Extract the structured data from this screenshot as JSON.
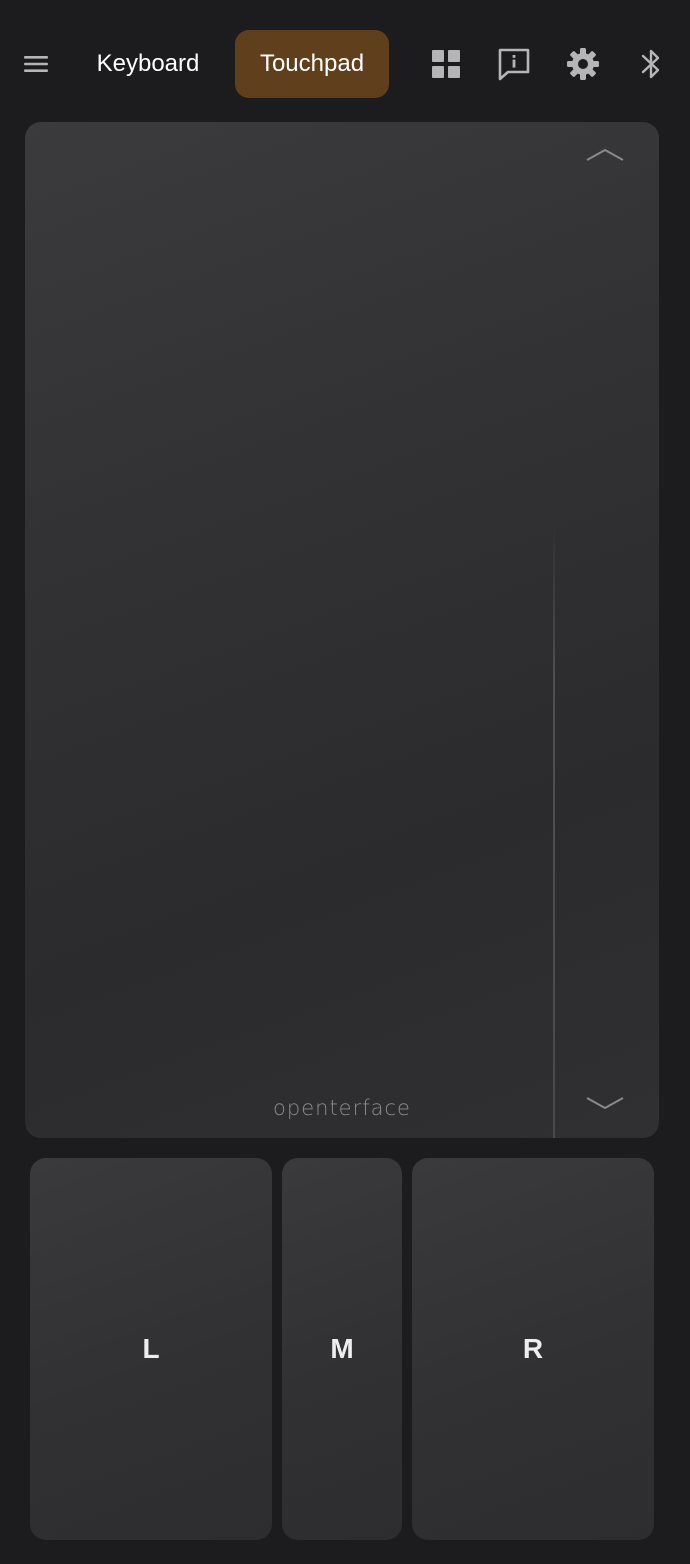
{
  "header": {
    "tabs": [
      {
        "label": "Keyboard",
        "active": false
      },
      {
        "label": "Touchpad",
        "active": true
      }
    ],
    "icons": [
      "menu-icon",
      "layout-grid-icon",
      "info-feedback-icon",
      "settings-gear-icon",
      "bluetooth-icon"
    ]
  },
  "touchpad": {
    "brand": "openterface",
    "scroll_controls": [
      "chevron-up-icon",
      "chevron-down-icon"
    ]
  },
  "mouse_buttons": {
    "left": "L",
    "middle": "M",
    "right": "R"
  },
  "colors": {
    "background": "#1c1c1e",
    "active_tab": "#60401c",
    "icon": "#b5b5b8",
    "button_surface": "#333335"
  }
}
